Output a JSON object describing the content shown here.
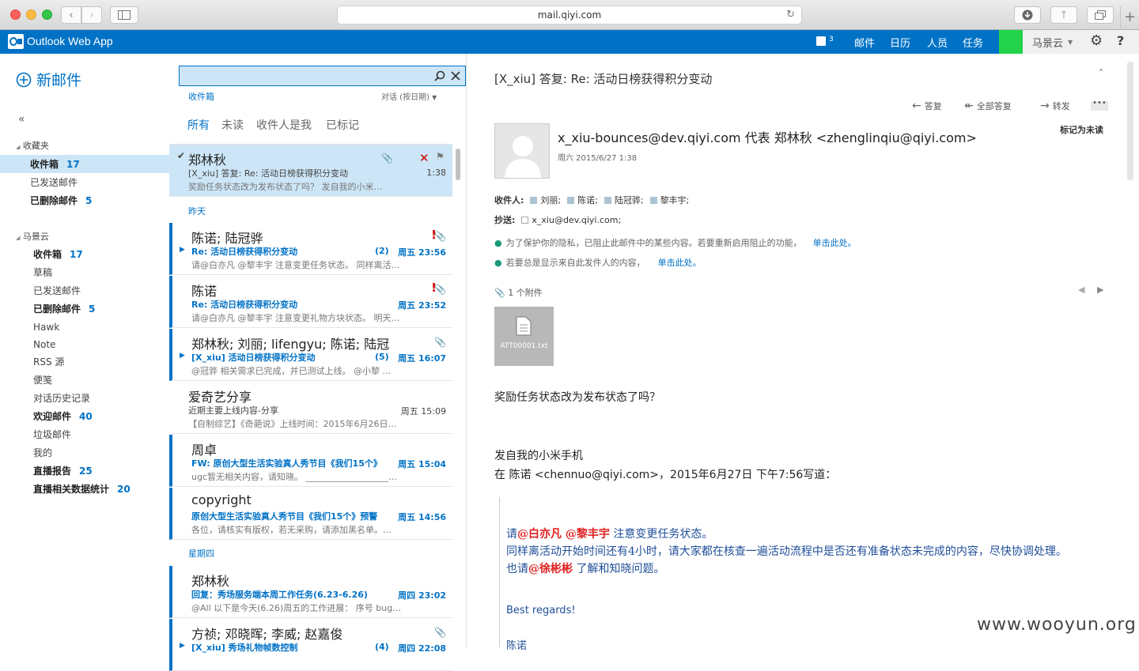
{
  "browser": {
    "url": "mail.qiyi.com"
  },
  "app": {
    "title": "Outlook Web App",
    "nav": [
      "邮件",
      "日历",
      "人员",
      "任务"
    ],
    "notif_count": "3",
    "user": "马景云",
    "colors": {
      "brand": "#0072c6",
      "status": "#22d34b"
    }
  },
  "sidebar": {
    "new_mail": "新邮件",
    "collapse": "«",
    "favorites_header": "收藏夹",
    "favorites": [
      {
        "label": "收件箱",
        "count": "17",
        "bold": true
      },
      {
        "label": "已发送邮件",
        "count": "",
        "bold": false
      },
      {
        "label": "已删除邮件",
        "count": "5",
        "bold": true
      }
    ],
    "account_header": "马景云",
    "folders": [
      {
        "label": "收件箱",
        "count": "17",
        "bold": true
      },
      {
        "label": "草稿",
        "count": "",
        "bold": false
      },
      {
        "label": "已发送邮件",
        "count": "",
        "bold": false
      },
      {
        "label": "已删除邮件",
        "count": "5",
        "bold": true
      },
      {
        "label": "Hawk",
        "count": "",
        "bold": false
      },
      {
        "label": "Note",
        "count": "",
        "bold": false
      },
      {
        "label": "RSS 源",
        "count": "",
        "bold": false
      },
      {
        "label": "便笺",
        "count": "",
        "bold": false
      },
      {
        "label": "对话历史记录",
        "count": "",
        "bold": false
      },
      {
        "label": "欢迎邮件",
        "count": "40",
        "bold": true
      },
      {
        "label": "垃圾邮件",
        "count": "",
        "bold": false
      },
      {
        "label": "我的",
        "count": "",
        "bold": false
      },
      {
        "label": "直播报告",
        "count": "25",
        "bold": true
      },
      {
        "label": "直播相关数据统计",
        "count": "20",
        "bold": true
      }
    ]
  },
  "list": {
    "search_placeholder": "",
    "folder_label": "收件箱",
    "sort_label": "对话 (按日期)",
    "filters": [
      "所有",
      "未读",
      "收件人是我",
      "已标记"
    ],
    "groups": [
      "昨天",
      "星期四"
    ],
    "messages": [
      {
        "sender": "郑林秋",
        "subject": "[X_xiu] 答复: Re: 活动日榜获得积分变动",
        "preview": "奖励任务状态改为发布状态了吗？    发自我的小米…",
        "time": "1:38",
        "count": "",
        "unread": false
      },
      {
        "sender": "陈诺; 陆冠骅",
        "subject": "Re: 活动日榜获得积分变动",
        "preview": "请@白亦凡 @黎丰宇 注意变更任务状态。 同样离活…",
        "time": "周五 23:56",
        "count": "(2)",
        "unread": true
      },
      {
        "sender": "陈诺",
        "subject": "Re: 活动日榜获得积分变动",
        "preview": "请@白亦凡 @黎丰宇 注意变更礼物方块状态。 明天…",
        "time": "周五 23:52",
        "count": "",
        "unread": true
      },
      {
        "sender": "郑林秋; 刘丽; lifengyu; 陈诺; 陆冠",
        "subject": "[X_xiu] 活动日榜获得积分变动",
        "preview": "@冠骅 相关需求已完成，并已测试上线。 @小黎 …",
        "time": "周五 16:07",
        "count": "(5)",
        "unread": true
      },
      {
        "sender": "爱奇艺分享",
        "subject": "近期主要上线内容-分享",
        "preview": "【自制综艺】《奇葩说》上线时间：2015年6月26日…",
        "time": "周五 15:09",
        "count": "",
        "unread": false
      },
      {
        "sender": "周卓",
        "subject": "FW: 原创大型生活实验真人秀节目《我们15个》",
        "preview": "ugc暂无相关内容，请知晓。 ___________________…",
        "time": "周五 15:04",
        "count": "",
        "unread": true
      },
      {
        "sender": "copyright",
        "subject": "原创大型生活实验真人秀节目《我们15个》预警",
        "preview": "各位，请核实有版权，若无采购，请添加黑名单。…",
        "time": "周五 14:56",
        "count": "",
        "unread": true
      },
      {
        "sender": "郑林秋",
        "subject": "回复：秀场服务端本周工作任务(6.23-6.26)",
        "preview": "@All 以下是今天(6.26)周五的工作进展： 序号 bug…",
        "time": "周四 23:02",
        "count": "",
        "unread": true
      },
      {
        "sender": "方祯; 邓晓晖; 李威; 赵嘉俊",
        "subject": "[X_xiu] 秀场礼物帧数控制",
        "preview": "",
        "time": "周四 22:08",
        "count": "(4)",
        "unread": true
      }
    ]
  },
  "reading": {
    "subject": "[X_xiu] 答复: Re: 活动日榜获得积分变动",
    "actions": [
      "答复",
      "全部答复",
      "转发"
    ],
    "mark_unread": "标记为未读",
    "from": "x_xiu-bounces@dev.qiyi.com 代表 郑林秋 <zhenglinqiu@qiyi.com>",
    "date": "周六 2015/6/27 1:38",
    "to_label": "收件人:",
    "to": [
      "刘丽;",
      "陈诺;",
      "陆冠骅;",
      "黎丰宇;"
    ],
    "cc_label": "抄送:",
    "cc": [
      "x_xiu@dev.qiyi.com;"
    ],
    "notice1": "为了保护你的隐私，已阻止此邮件中的某些内容。若要重新启用阻止的功能，",
    "notice1_link": "单击此处。",
    "notice2": "若要总是显示来自此发件人的内容，",
    "notice2_link": "单击此处。",
    "attach_count": "1 个附件",
    "attachment": "ATT00001.txt",
    "body1": "奖励任务状态改为发布状态了吗？",
    "body2": "发自我的小米手机",
    "body3": "在 陈诺 <chennuo@qiyi.com>，2015年6月27日 下午7:56写道：",
    "quote": {
      "l1a": "请",
      "l1b": "@白亦凡  @黎丰宇",
      "l1c": " 注意变更任务状态。",
      "l2": "同样离活动开始时间还有4小时，请大家都在核查一遍活动流程中是否还有准备状态未完成的内容，尽快协调处理。",
      "l3a": "也请",
      "l3b": "@徐彬彬",
      "l3c": " 了解和知晓问题。",
      "l4": "Best regards!",
      "l5": "陈诺"
    }
  },
  "watermark": "www.wooyun.org"
}
